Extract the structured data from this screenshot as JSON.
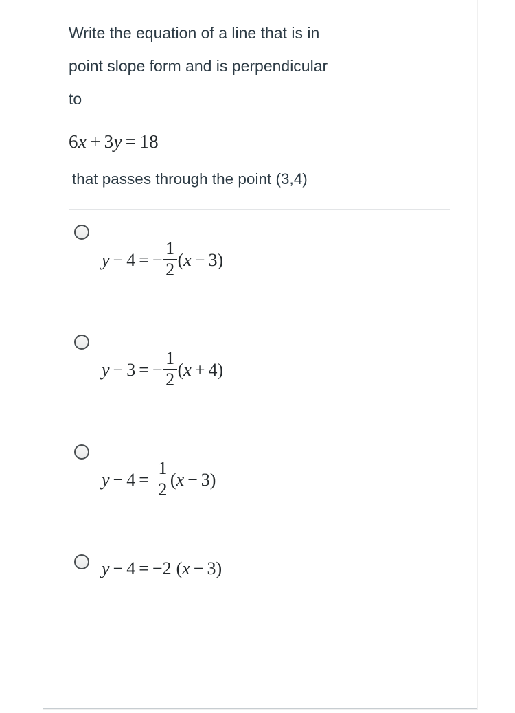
{
  "question": {
    "prompt_lines": [
      "Write the equation of a line that is in",
      "point slope form and is perpendicular",
      "to"
    ],
    "equation": {
      "coef_x": "6",
      "var_x": "x",
      "plus": "+",
      "coef_y": "3",
      "var_y": "y",
      "equals": "=",
      "rhs": "18",
      "plain": "6x + 3y = 18"
    },
    "tail": "that passes through the point (3,4)"
  },
  "options": [
    {
      "id": "option-1",
      "selected": false,
      "plain": "y − 4 = −1/2(x − 3)",
      "lhs_var": "y",
      "lhs_op": "−",
      "lhs_num": "4",
      "equals": "=",
      "sign": "−",
      "has_fraction": true,
      "numerator": "1",
      "denominator": "2",
      "paren_open": "(",
      "paren_var": "x",
      "paren_op": "−",
      "paren_num": "3",
      "paren_close": ")"
    },
    {
      "id": "option-2",
      "selected": false,
      "plain": "y − 3 = −1/2(x + 4)",
      "lhs_var": "y",
      "lhs_op": "−",
      "lhs_num": "3",
      "equals": "=",
      "sign": "−",
      "has_fraction": true,
      "numerator": "1",
      "denominator": "2",
      "paren_open": "(",
      "paren_var": "x",
      "paren_op": "+",
      "paren_num": "4",
      "paren_close": ")"
    },
    {
      "id": "option-3",
      "selected": false,
      "plain": "y − 4 = 1/2(x − 3)",
      "lhs_var": "y",
      "lhs_op": "−",
      "lhs_num": "4",
      "equals": "=",
      "sign": "",
      "has_fraction": true,
      "numerator": "1",
      "denominator": "2",
      "paren_open": "(",
      "paren_var": "x",
      "paren_op": "−",
      "paren_num": "3",
      "paren_close": ")"
    },
    {
      "id": "option-4",
      "selected": false,
      "plain": "y − 4 = −2 (x − 3)",
      "lhs_var": "y",
      "lhs_op": "−",
      "lhs_num": "4",
      "equals": "=",
      "sign": "−",
      "has_fraction": false,
      "coefficient": "2",
      "paren_open": "(",
      "paren_var": "x",
      "paren_op": "−",
      "paren_num": "3",
      "paren_close": ")"
    }
  ],
  "colors": {
    "text": "#2d3b45",
    "math": "#23282b",
    "card_border": "#c7cdd1",
    "divider": "#e3e5e7",
    "radio_border": "#4a4f52"
  }
}
